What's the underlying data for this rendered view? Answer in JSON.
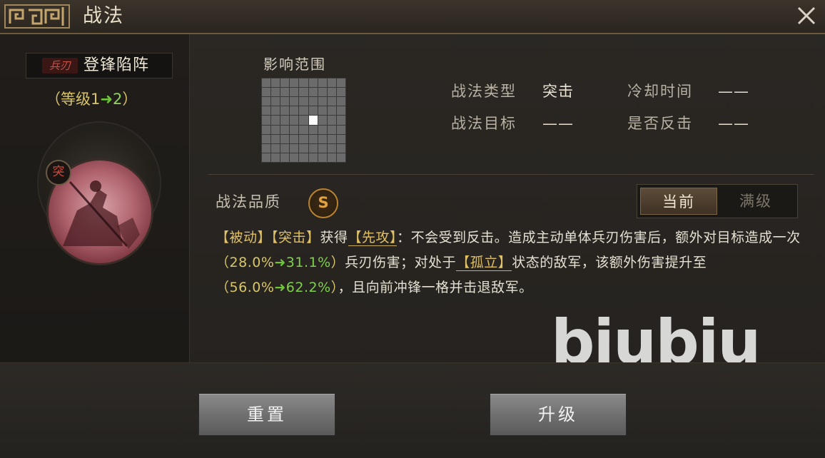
{
  "header": {
    "title": "战法",
    "close_icon": "close-icon"
  },
  "skill": {
    "weapon_tag": "兵刃",
    "name": "登锋陷阵",
    "level_prefix": "（等级",
    "level_from": "1",
    "level_arrow": "➜",
    "level_to": "2",
    "level_suffix": "）",
    "type_badge": "突"
  },
  "range": {
    "label": "影响范围",
    "grid_size": 9,
    "hit_cell": [
      4,
      5
    ]
  },
  "stats": {
    "type_label": "战法类型",
    "type_value": "突击",
    "cooldown_label": "冷却时间",
    "cooldown_value": "——",
    "target_label": "战法目标",
    "target_value": "——",
    "counter_label": "是否反击",
    "counter_value": "——"
  },
  "quality": {
    "label": "战法品质",
    "grade": "S"
  },
  "toggle": {
    "current": "当前",
    "max": "满级"
  },
  "description": {
    "kw_passive": "【被动】",
    "kw_assault": "【突击】",
    "t1": "获得",
    "kw_first": "【先攻】",
    "t2": "：不会受到反击。造成主动单体兵刃伤害后，额外对目标造成一次",
    "p1_open": "（",
    "p1_old": "28.0%",
    "p1_new": "31.1%",
    "p1_close": "）",
    "t3": "兵刃伤害；对处于",
    "kw_isolated": "【孤立】",
    "t4": "状态的敌军，该额外伤害提升至",
    "p2_open": "（",
    "p2_old": "56.0%",
    "p2_new": "62.2%",
    "p2_close": "）",
    "t5": "，且向前冲锋一格并击退敌军。",
    "arrow": "➜"
  },
  "watermark": "biubiu",
  "buttons": {
    "reset": "重置",
    "upgrade": "升级"
  },
  "colors": {
    "old_value": "#d9c66a",
    "new_value": "#7fd04a",
    "keyword": "#e0c064",
    "quality": "#e3a240"
  }
}
